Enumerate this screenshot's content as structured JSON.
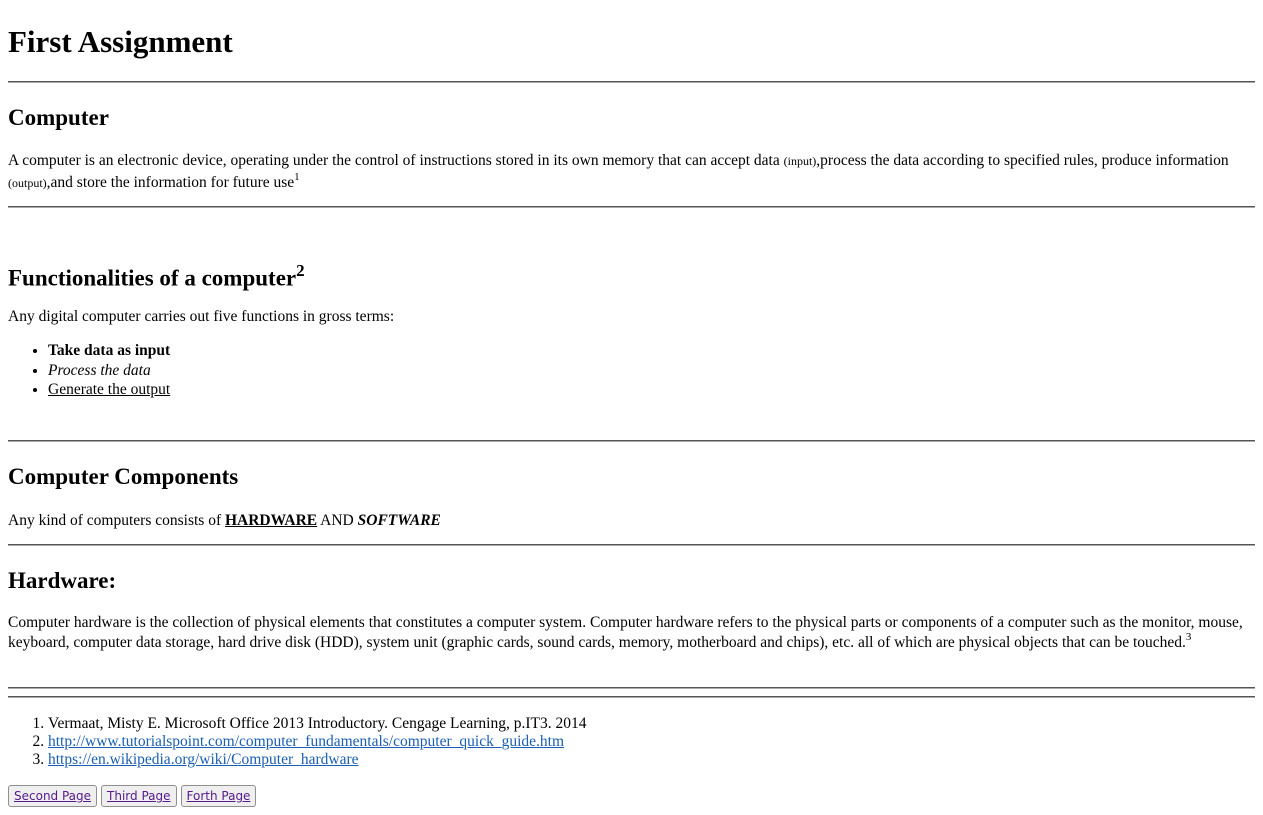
{
  "page": {
    "title": "First Assignment"
  },
  "computer": {
    "heading": "Computer",
    "text_a": "A computer is an electronic device, operating under the control of instructions stored in its own memory that can accept data ",
    "input_note": "(input)",
    "text_b": ",process the data according to specified rules, produce information ",
    "output_note": "(output)",
    "text_c": ",and store the information for future use",
    "footnote": "1"
  },
  "functionalities": {
    "heading": "Functionalities of a computer",
    "footnote": "2",
    "intro": "Any digital computer carries out five functions in gross terms:",
    "items": [
      "Take data as input",
      "Process the data",
      "Generate the output"
    ]
  },
  "components": {
    "heading": "Computer Components",
    "text": "Any kind of computers consists of ",
    "hardware": "HARDWARE",
    "and": " AND ",
    "software": "SOFTWARE"
  },
  "hardware": {
    "heading": "Hardware:",
    "text": "Computer hardware is the collection of physical elements that constitutes a computer system. Computer hardware refers to the physical parts or components of a computer such as the monitor, mouse, keyboard, computer data storage, hard drive disk (HDD), system unit (graphic cards, sound cards, memory, motherboard and chips), etc. all of which are physical objects that can be touched.",
    "footnote": "3"
  },
  "references": [
    "Vermaat, Misty E. Microsoft Office 2013 Introductory. Cengage Learning, p.IT3. 2014",
    "http://www.tutorialspoint.com/computer_fundamentals/computer_quick_guide.htm",
    "https://en.wikipedia.org/wiki/Computer_hardware"
  ],
  "nav_buttons": [
    "Second Page",
    "Third Page",
    "Forth Page"
  ]
}
